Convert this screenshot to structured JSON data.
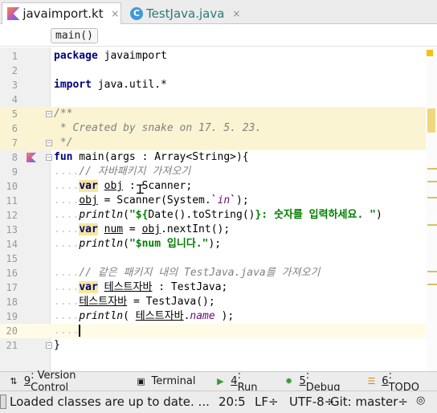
{
  "tabs": [
    {
      "label": "javaimport.kt",
      "close": "×",
      "active": true
    },
    {
      "label": "TestJava.java",
      "close": "×",
      "active": false
    }
  ],
  "breadcrumb": "main()",
  "lines": [
    {
      "n": "1"
    },
    {
      "n": "2"
    },
    {
      "n": "3"
    },
    {
      "n": "4"
    },
    {
      "n": "5"
    },
    {
      "n": "6"
    },
    {
      "n": "7"
    },
    {
      "n": "8"
    },
    {
      "n": "9"
    },
    {
      "n": "10"
    },
    {
      "n": "11"
    },
    {
      "n": "12"
    },
    {
      "n": "13"
    },
    {
      "n": "14"
    },
    {
      "n": "15"
    },
    {
      "n": "16"
    },
    {
      "n": "17"
    },
    {
      "n": "18"
    },
    {
      "n": "19"
    },
    {
      "n": "20"
    },
    {
      "n": "21"
    }
  ],
  "code": {
    "l1_kw": "package",
    "l1_rest": " javaimport",
    "l3_kw": "import",
    "l3_rest": " java.util.*",
    "l5": "/**",
    "l6": " * Created by snake on 17. 5. 23.",
    "l7": " */",
    "l8_kw": "fun",
    "l8_rest": " main(args : Array<String>){",
    "l9_ws": "....",
    "l9_cmt": "// 자바패키지 가져오기",
    "l10_ws": "....",
    "l10_kw": "var",
    "l10_a": " ",
    "l10_var": "obj",
    "l10_b": " : Scanner;",
    "l11_ws": "....",
    "l11_var": "obj",
    "l11_b": " = Scanner(System.`",
    "l11_in": "in",
    "l11_c": "`);",
    "l12_ws": "....",
    "l12_fn": "println",
    "l12_a": "(",
    "l12_s1": "\"${",
    "l12_b": "Date().toString()",
    "l12_s2": "}: 숫자를 입력하세요. \"",
    "l12_c": ")",
    "l13_ws": "....",
    "l13_kw": "var",
    "l13_a": " ",
    "l13_var": "num",
    "l13_b": " = ",
    "l13_var2": "obj",
    "l13_c": ".nextInt();",
    "l14_ws": "....",
    "l14_fn": "println",
    "l14_a": "(",
    "l14_s": "\"$num 입니다.\"",
    "l14_b": ");",
    "l16_ws": "....",
    "l16_cmt": "// 같은 패키지 내의 TestJava.java를 가져오기",
    "l17_ws": "....",
    "l17_kw": "var",
    "l17_a": " ",
    "l17_var": "테스트자바",
    "l17_b": " : TestJava;",
    "l18_ws": "....",
    "l18_var": "테스트자바",
    "l18_b": " = TestJava();",
    "l19_ws": "....",
    "l19_fn": "println",
    "l19_a": "( ",
    "l19_var": "테스트자바",
    "l19_b": ".",
    "l19_prop": "name",
    "l19_c": " );",
    "l20_ws": "....",
    "l21": "}"
  },
  "tool_windows": [
    {
      "key": "9",
      "label": ": Version Control",
      "icon": "version-control-icon"
    },
    {
      "key": "",
      "label": "Terminal",
      "icon": "terminal-icon"
    },
    {
      "key": "4",
      "label": ": Run",
      "icon": "run-icon"
    },
    {
      "key": "5",
      "label": ": Debug",
      "icon": "debug-icon"
    },
    {
      "key": "6",
      "label": ": TODO",
      "icon": "todo-icon"
    }
  ],
  "status": {
    "message": "Loaded classes are up to date. ...",
    "position": "20:5",
    "line_sep": "LF÷",
    "encoding": "UTF-8÷",
    "git": "Git: master÷"
  },
  "colors": {
    "keyword": "#000080",
    "comment": "#808080",
    "string": "#008000",
    "property": "#660e7a",
    "doc_bg": "#fbf4d3"
  }
}
